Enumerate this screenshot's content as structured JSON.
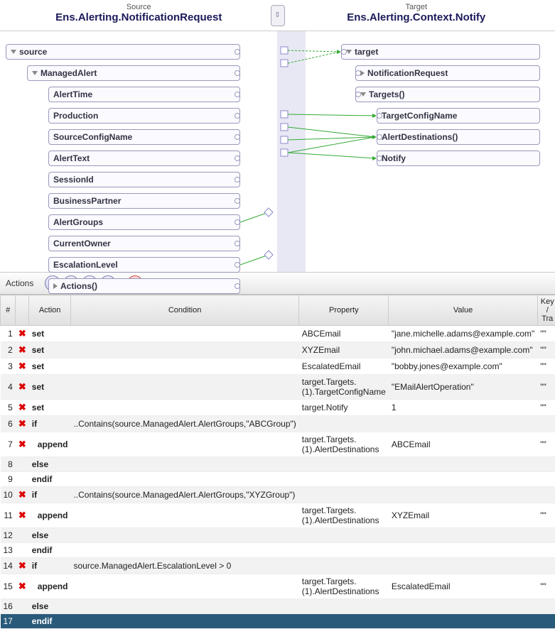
{
  "header": {
    "source_sublabel": "Source",
    "source_title": "Ens.Alerting.NotificationRequest",
    "target_sublabel": "Target",
    "target_title": "Ens.Alerting.Context.Notify"
  },
  "source_tree": {
    "root": "source",
    "managed_alert": "ManagedAlert",
    "fields": [
      "AlertTime",
      "Production",
      "SourceConfigName",
      "AlertText",
      "SessionId",
      "BusinessPartner",
      "AlertGroups",
      "CurrentOwner",
      "EscalationLevel",
      "Actions()"
    ]
  },
  "target_tree": {
    "root": "target",
    "notification_request": "NotificationRequest",
    "targets": "Targets()",
    "target_config_name": "TargetConfigName",
    "alert_destinations": "AlertDestinations()",
    "notify": "Notify"
  },
  "actions_section": {
    "label": "Actions",
    "columns": [
      "#",
      "",
      "Action",
      "Condition",
      "Property",
      "Value",
      "Key / Tra"
    ]
  },
  "actions": [
    {
      "n": "1",
      "del": true,
      "action": "set",
      "condition": "",
      "property": "ABCEmail",
      "value": "\"jane.michelle.adams@example.com\"",
      "key": "\"\"",
      "indent": 0
    },
    {
      "n": "2",
      "del": true,
      "action": "set",
      "condition": "",
      "property": "XYZEmail",
      "value": "\"john.michael.adams@example.com\"",
      "key": "\"\"",
      "indent": 0
    },
    {
      "n": "3",
      "del": true,
      "action": "set",
      "condition": "",
      "property": "EscalatedEmail",
      "value": "\"bobby.jones@example.com\"",
      "key": "\"\"",
      "indent": 0
    },
    {
      "n": "4",
      "del": true,
      "action": "set",
      "condition": "",
      "property": "target.Targets.(1).TargetConfigName",
      "value": "\"EMailAlertOperation\"",
      "key": "\"\"",
      "indent": 0
    },
    {
      "n": "5",
      "del": true,
      "action": "set",
      "condition": "",
      "property": "target.Notify",
      "value": "1",
      "key": "\"\"",
      "indent": 0
    },
    {
      "n": "6",
      "del": true,
      "action": "if",
      "condition": "..Contains(source.ManagedAlert.AlertGroups,\"ABCGroup\")",
      "property": "",
      "value": "",
      "key": "",
      "indent": 0
    },
    {
      "n": "7",
      "del": true,
      "action": "append",
      "condition": "",
      "property": "target.Targets.(1).AlertDestinations",
      "value": "ABCEmail",
      "key": "\"\"",
      "indent": 1
    },
    {
      "n": "8",
      "del": false,
      "action": "else",
      "condition": "",
      "property": "",
      "value": "",
      "key": "",
      "indent": 0
    },
    {
      "n": "9",
      "del": false,
      "action": "endif",
      "condition": "",
      "property": "",
      "value": "",
      "key": "",
      "indent": 0
    },
    {
      "n": "10",
      "del": true,
      "action": "if",
      "condition": "..Contains(source.ManagedAlert.AlertGroups,\"XYZGroup\")",
      "property": "",
      "value": "",
      "key": "",
      "indent": 0
    },
    {
      "n": "11",
      "del": true,
      "action": "append",
      "condition": "",
      "property": "target.Targets.(1).AlertDestinations",
      "value": "XYZEmail",
      "key": "\"\"",
      "indent": 1
    },
    {
      "n": "12",
      "del": false,
      "action": "else",
      "condition": "",
      "property": "",
      "value": "",
      "key": "",
      "indent": 0
    },
    {
      "n": "13",
      "del": false,
      "action": "endif",
      "condition": "",
      "property": "",
      "value": "",
      "key": "",
      "indent": 0
    },
    {
      "n": "14",
      "del": true,
      "action": "if",
      "condition": "source.ManagedAlert.EscalationLevel > 0",
      "property": "",
      "value": "",
      "key": "",
      "indent": 0
    },
    {
      "n": "15",
      "del": true,
      "action": "append",
      "condition": "",
      "property": "target.Targets.(1).AlertDestinations",
      "value": "EscalatedEmail",
      "key": "\"\"",
      "indent": 1
    },
    {
      "n": "16",
      "del": false,
      "action": "else",
      "condition": "",
      "property": "",
      "value": "",
      "key": "",
      "indent": 0
    },
    {
      "n": "17",
      "del": false,
      "action": "endif",
      "condition": "",
      "property": "",
      "value": "",
      "key": "",
      "indent": 0,
      "selected": true
    }
  ]
}
